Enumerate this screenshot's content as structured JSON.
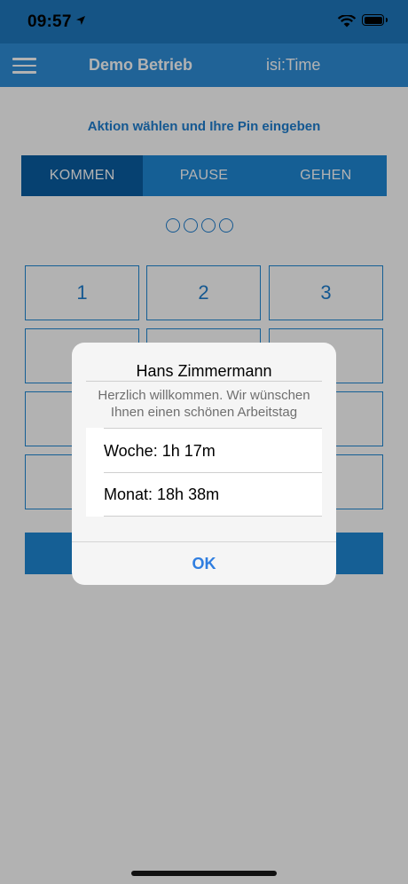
{
  "status_bar": {
    "time": "09:57",
    "icons": [
      "location-arrow-icon",
      "wifi-icon",
      "battery-icon"
    ]
  },
  "nav": {
    "title": "Demo Betrieb",
    "right_label": "isi:Time",
    "menu_icon": "hamburger-menu-icon"
  },
  "instruction": "Aktion wählen und Ihre Pin eingeben",
  "segments": [
    {
      "label": "KOMMEN",
      "selected": true
    },
    {
      "label": "PAUSE",
      "selected": false
    },
    {
      "label": "GEHEN",
      "selected": false
    }
  ],
  "pin_length": 4,
  "keypad": {
    "keys": [
      "1",
      "2",
      "3"
    ]
  },
  "dialog": {
    "title": "Hans Zimmermann",
    "message": "Herzlich willkommen. Wir wünschen Ihnen einen schönen Arbeitstag",
    "rows": [
      {
        "label": "Woche: 1h 17m"
      },
      {
        "label": "Monat: 18h 38m"
      }
    ],
    "ok_label": "OK"
  },
  "colors": {
    "status_bar": "#1f79bf",
    "nav_bar": "#2f8fd9",
    "accent": "#1f88d6",
    "segment_active": "#0a5ea3",
    "dialog_button": "#2f7ee0"
  }
}
